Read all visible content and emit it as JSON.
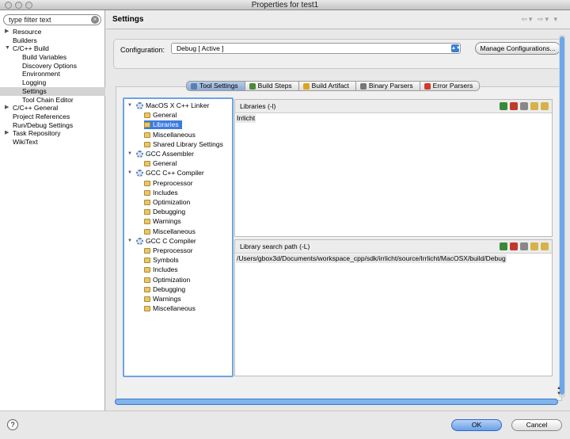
{
  "window": {
    "title": "Properties for test1"
  },
  "filter": {
    "value": "type filter text"
  },
  "nav": [
    {
      "label": "Resource",
      "level": 0,
      "arrow": "▶"
    },
    {
      "label": "Builders",
      "level": 0,
      "arrow": ""
    },
    {
      "label": "C/C++ Build",
      "level": 0,
      "arrow": "▼"
    },
    {
      "label": "Build Variables",
      "level": 1,
      "arrow": ""
    },
    {
      "label": "Discovery Options",
      "level": 1,
      "arrow": ""
    },
    {
      "label": "Environment",
      "level": 1,
      "arrow": ""
    },
    {
      "label": "Logging",
      "level": 1,
      "arrow": ""
    },
    {
      "label": "Settings",
      "level": 1,
      "arrow": "",
      "selected": true
    },
    {
      "label": "Tool Chain Editor",
      "level": 1,
      "arrow": ""
    },
    {
      "label": "C/C++ General",
      "level": 0,
      "arrow": "▶"
    },
    {
      "label": "Project References",
      "level": 0,
      "arrow": ""
    },
    {
      "label": "Run/Debug Settings",
      "level": 0,
      "arrow": ""
    },
    {
      "label": "Task Repository",
      "level": 0,
      "arrow": "▶"
    },
    {
      "label": "WikiText",
      "level": 0,
      "arrow": ""
    }
  ],
  "header": {
    "title": "Settings"
  },
  "config": {
    "label": "Configuration:",
    "value": "Debug  [ Active ]",
    "manage_label": "Manage Configurations..."
  },
  "tabs": [
    {
      "label": "Tool Settings",
      "color": "#5b7fb3",
      "active": true
    },
    {
      "label": "Build Steps",
      "color": "#4a8a3a"
    },
    {
      "label": "Build Artifact",
      "color": "#d9a520"
    },
    {
      "label": "Binary Parsers",
      "color": "#777777"
    },
    {
      "label": "Error Parsers",
      "color": "#d03a2a"
    }
  ],
  "tree": [
    {
      "label": "MacOS X C++ Linker",
      "kind": "tool"
    },
    {
      "label": "General",
      "kind": "page"
    },
    {
      "label": "Libraries",
      "kind": "page",
      "selected": true
    },
    {
      "label": "Miscellaneous",
      "kind": "page"
    },
    {
      "label": "Shared Library Settings",
      "kind": "page"
    },
    {
      "label": "GCC Assembler",
      "kind": "tool"
    },
    {
      "label": "General",
      "kind": "page"
    },
    {
      "label": "GCC C++ Compiler",
      "kind": "tool"
    },
    {
      "label": "Preprocessor",
      "kind": "page"
    },
    {
      "label": "Includes",
      "kind": "page"
    },
    {
      "label": "Optimization",
      "kind": "page"
    },
    {
      "label": "Debugging",
      "kind": "page"
    },
    {
      "label": "Warnings",
      "kind": "page"
    },
    {
      "label": "Miscellaneous",
      "kind": "page"
    },
    {
      "label": "GCC C Compiler",
      "kind": "tool"
    },
    {
      "label": "Preprocessor",
      "kind": "page"
    },
    {
      "label": "Symbols",
      "kind": "page"
    },
    {
      "label": "Includes",
      "kind": "page"
    },
    {
      "label": "Optimization",
      "kind": "page"
    },
    {
      "label": "Debugging",
      "kind": "page"
    },
    {
      "label": "Warnings",
      "kind": "page"
    },
    {
      "label": "Miscellaneous",
      "kind": "page"
    }
  ],
  "libraries": {
    "title": "Libraries (-l)",
    "values": [
      "Irrlicht"
    ]
  },
  "libpath": {
    "title": "Library search path (-L)",
    "values": [
      "/Users/gbox3d/Documents/workspace_cpp/sdk/irrlicht/source/Irrlicht/MacOSX/build/Debug"
    ]
  },
  "pane_tool_icons": [
    {
      "name": "add-icon",
      "color": "#3a8a3a"
    },
    {
      "name": "delete-icon",
      "color": "#c0392b"
    },
    {
      "name": "edit-icon",
      "color": "#888888"
    },
    {
      "name": "move-up-icon",
      "color": "#d6b24a"
    },
    {
      "name": "move-down-icon",
      "color": "#d6b24a"
    }
  ],
  "buttons": {
    "help": "?",
    "ok": "OK",
    "cancel": "Cancel"
  }
}
